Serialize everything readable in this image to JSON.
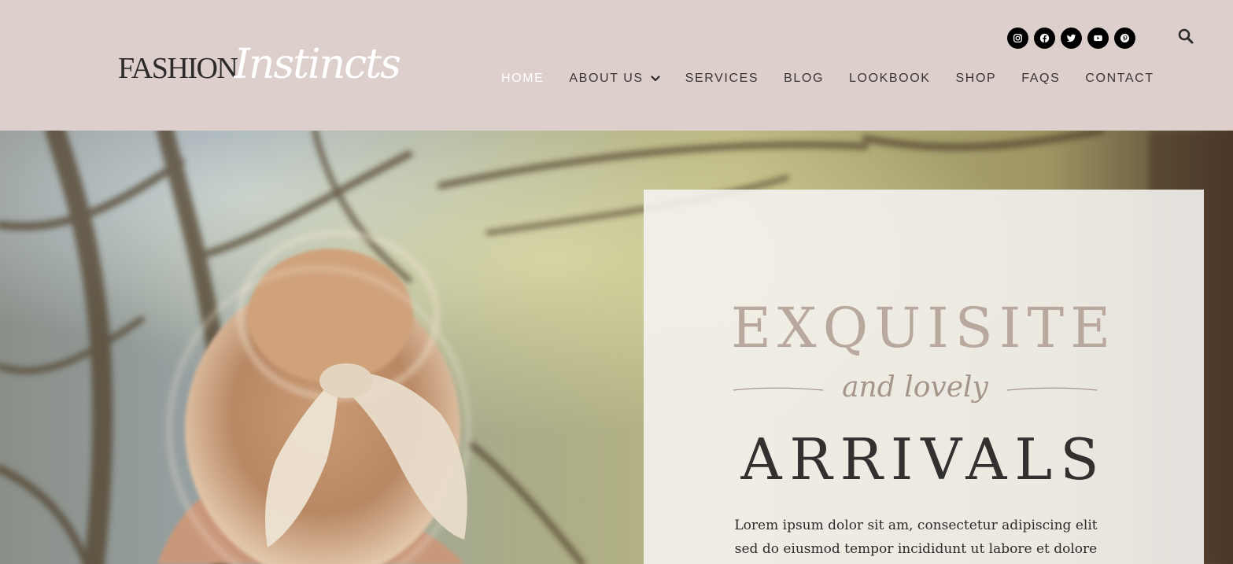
{
  "brand": {
    "logo_part1": "FASHION",
    "logo_part2": "Instincts"
  },
  "social": [
    {
      "name": "instagram"
    },
    {
      "name": "facebook"
    },
    {
      "name": "twitter"
    },
    {
      "name": "youtube"
    },
    {
      "name": "pinterest"
    }
  ],
  "nav": {
    "items": [
      {
        "label": "HOME",
        "active": true
      },
      {
        "label": "ABOUT US",
        "has_dropdown": true
      },
      {
        "label": "SERVICES"
      },
      {
        "label": "BLOG"
      },
      {
        "label": "LOOKBOOK"
      },
      {
        "label": "SHOP"
      },
      {
        "label": "FAQS"
      },
      {
        "label": "CONTACT"
      }
    ]
  },
  "hero": {
    "headline_top": "EXQUISITE",
    "headline_mid": "and lovely",
    "headline_bottom": "ARRIVALS",
    "body_line1": "Lorem ipsum dolor sit am, consectetur adipiscing elit",
    "body_line2": "sed do eiusmod tempor incididunt ut labore et dolore"
  },
  "colors": {
    "header_bg": "#ddd0cc",
    "accent_taupe": "#b8a89e",
    "dark_text": "#333030",
    "nav_active": "#ffffff",
    "card_bg": "#f4f2ee"
  },
  "icons": {
    "search": "search-icon",
    "dropdown": "chevron-down-icon"
  }
}
